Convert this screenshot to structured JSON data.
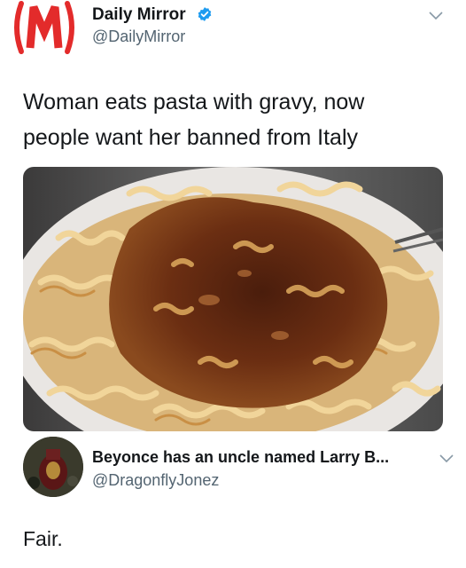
{
  "tweet": {
    "display_name": "Daily Mirror",
    "handle": "@DailyMirror",
    "verified": true,
    "text_line1": "Woman eats pasta with gravy, now",
    "text_line2": "people want her banned from Italy",
    "avatar_icon": "daily-mirror-logo-icon",
    "media_description_icon": "pasta-with-gravy-photo",
    "brand_color": "#e32b2b",
    "verified_color": "#1d9bf0"
  },
  "reply": {
    "display_name": "Beyonce has an uncle named Larry B...",
    "handle": "@DragonflyJonez",
    "text": "Fair.",
    "avatar_icon": "user-avatar-icon"
  }
}
